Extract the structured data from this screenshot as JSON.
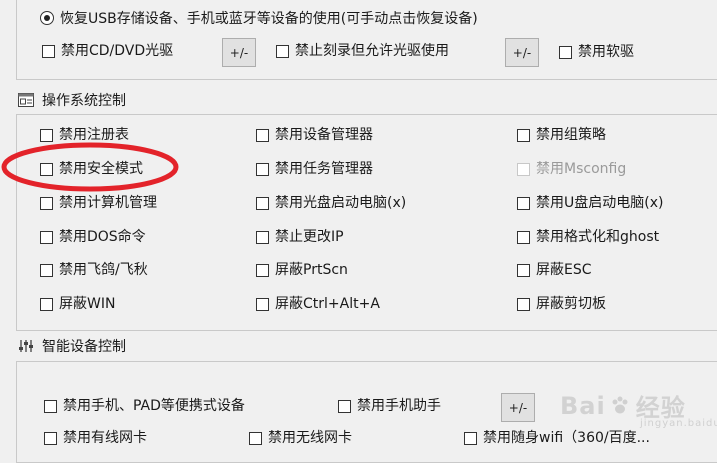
{
  "usb_group": {
    "restore_radio_label": "恢复USB存储设备、手机或蓝牙等设备的使用(可手动点击恢复设备)",
    "disable_cd_label": "禁用CD/DVD光驱",
    "toggle_label": "+/-",
    "no_burn_label": "禁止刻录但允许光驱使用",
    "toggle2_label": "+/-",
    "disable_floppy_label": "禁用软驱"
  },
  "os_control": {
    "title": "操作系统控制",
    "items": [
      {
        "label": "禁用注册表"
      },
      {
        "label": "禁用设备管理器"
      },
      {
        "label": "禁用组策略"
      },
      {
        "label": "禁用安全模式"
      },
      {
        "label": "禁用任务管理器"
      },
      {
        "label": "禁用Msconfig",
        "disabled": true
      },
      {
        "label": "禁用计算机管理"
      },
      {
        "label": "禁用光盘启动电脑(x)"
      },
      {
        "label": "禁用U盘启动电脑(x)"
      },
      {
        "label": "禁用DOS命令"
      },
      {
        "label": "禁止更改IP"
      },
      {
        "label": "禁用格式化和ghost"
      },
      {
        "label": "禁用飞鸽/飞秋"
      },
      {
        "label": "屏蔽PrtScn"
      },
      {
        "label": "屏蔽ESC"
      },
      {
        "label": "屏蔽WIN"
      },
      {
        "label": "屏蔽Ctrl+Alt+A"
      },
      {
        "label": "屏蔽剪切板"
      }
    ]
  },
  "smart_device": {
    "title": "智能设备控制",
    "portable_label": "禁用手机、PAD等便携式设备",
    "phone_assistant_label": "禁用手机助手",
    "toggle_label": "+/-",
    "wired_nic_label": "禁用有线网卡",
    "wireless_nic_label": "禁用无线网卡",
    "portable_wifi_label": "禁用随身wifi（360/百度..."
  },
  "watermark": {
    "brand": "Bai",
    "suffix": "经验",
    "sub": "jingyan.baidu.com"
  },
  "colors": {
    "highlight_ellipse": "#e3232a"
  }
}
